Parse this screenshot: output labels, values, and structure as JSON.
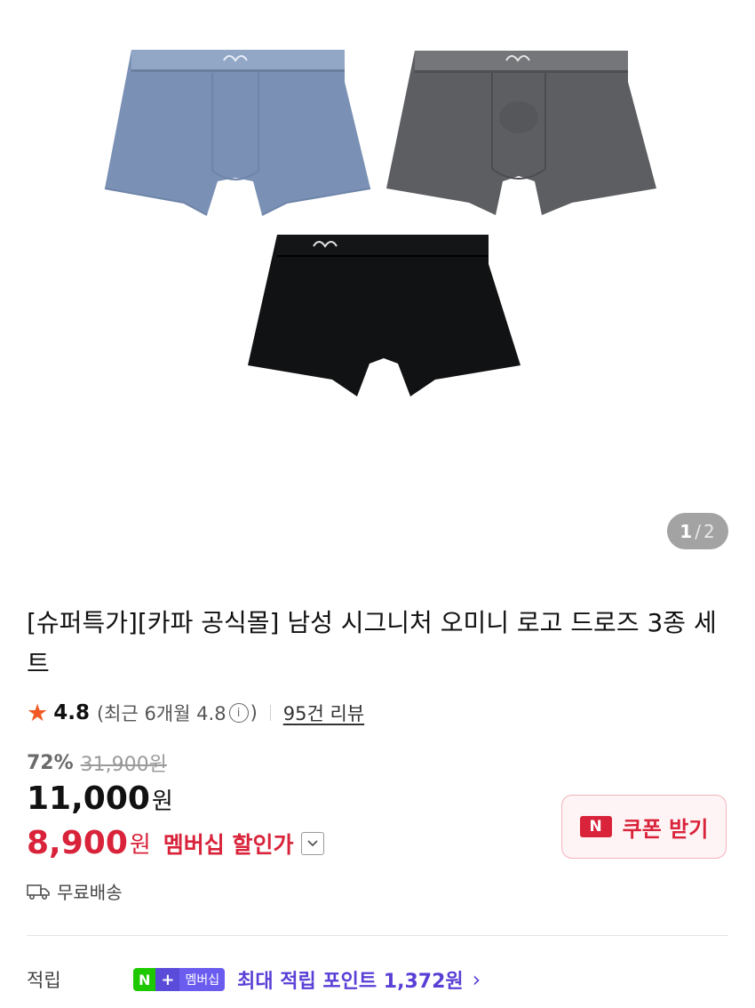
{
  "gallery": {
    "page_current": "1",
    "page_separator": "/",
    "page_total": "2",
    "products": [
      {
        "name": "blue-trunks",
        "color": "#7a90b4",
        "band_color": "#92a6c6",
        "logo": "Kappa"
      },
      {
        "name": "gray-trunks",
        "color": "#5c5e61",
        "band_color": "#747679",
        "logo": "Kappa"
      },
      {
        "name": "black-trunks",
        "color": "#111213",
        "band_color": "#141516",
        "logo": "Kappa"
      }
    ]
  },
  "product": {
    "title": "[슈퍼특가][카파 공식몰] 남성 시그니처 오미니 로고 드로즈 3종 세트"
  },
  "rating": {
    "score": "4.8",
    "recent_prefix": "(최근 6개월 4.8",
    "recent_suffix": ")",
    "info_icon": "i",
    "review_link": "95건 리뷰"
  },
  "pricing": {
    "discount_pct": "72%",
    "original_price": "31,900원",
    "price": "11,000",
    "price_unit": "원",
    "member_price": "8,900",
    "member_unit": "원",
    "member_label": "멤버십 할인가",
    "accent_color": "#d9233a"
  },
  "coupon": {
    "logo_text": "N",
    "label": "쿠폰 받기"
  },
  "shipping": {
    "label": "무료배송",
    "icon": "truck-icon"
  },
  "points": {
    "label": "적립",
    "badge_n": "N",
    "badge_plus": "+",
    "badge_membership": "멤버십",
    "text": "최대 적립 포인트 1,372원",
    "chevron": "›"
  }
}
